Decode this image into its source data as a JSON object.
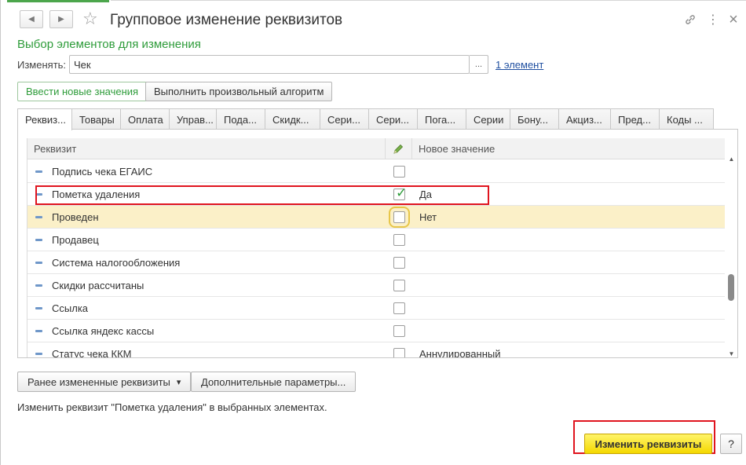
{
  "window": {
    "title": "Групповое изменение реквизитов",
    "subtitle": "Выбор элементов для изменения"
  },
  "icons": {
    "back": "◀",
    "forward": "▶",
    "star": "☆",
    "link": "🔗",
    "more": "⋮",
    "close": "×",
    "pencil": "✎",
    "check": "✓",
    "dropdown": "▾"
  },
  "change": {
    "label": "Изменять:",
    "value": "Чек",
    "ellipsis": "...",
    "elements_link": "1 элемент"
  },
  "modes": [
    {
      "label": "Ввести новые значения",
      "active": true
    },
    {
      "label": "Выполнить произвольный алгоритм",
      "active": false
    }
  ],
  "tabs": [
    "Реквиз...",
    "Товары",
    "Оплата",
    "Управ...",
    "Пода...",
    "Скидк...",
    "Сери...",
    "Сери...",
    "Пога...",
    "Серии",
    "Бону...",
    "Акциз...",
    "Пред...",
    "Коды ..."
  ],
  "table": {
    "headers": {
      "attribute": "Реквизит",
      "new_value": "Новое значение"
    },
    "rows": [
      {
        "name": "Подпись чека ЕГАИС",
        "checked": false,
        "value": ""
      },
      {
        "name": "Пометка удаления",
        "checked": true,
        "value": "Да"
      },
      {
        "name": "Проведен",
        "checked": false,
        "value": "Нет",
        "selected": true
      },
      {
        "name": "Продавец",
        "checked": false,
        "value": ""
      },
      {
        "name": "Система налогообложения",
        "checked": false,
        "value": ""
      },
      {
        "name": "Скидки рассчитаны",
        "checked": false,
        "value": ""
      },
      {
        "name": "Ссылка",
        "checked": false,
        "value": ""
      },
      {
        "name": "Ссылка яндекс кассы",
        "checked": false,
        "value": ""
      },
      {
        "name": "Статус чека ККМ",
        "checked": false,
        "value": "Аннулированный"
      }
    ]
  },
  "buttons": {
    "previously_changed": "Ранее измененные реквизиты",
    "additional_params": "Дополнительные параметры...",
    "apply": "Изменить реквизиты",
    "help": "?"
  },
  "status": "Изменить реквизит \"Пометка удаления\" в выбранных элементах.",
  "colors": {
    "accent_green": "#2e9c3a",
    "highlight_red": "#e0141e",
    "primary_yellow": "#f4d800",
    "selected_row": "#fbf0c8"
  }
}
